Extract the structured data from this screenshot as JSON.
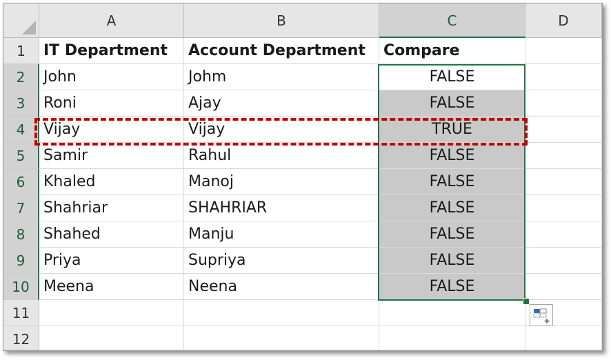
{
  "columns": [
    "A",
    "B",
    "C",
    "D"
  ],
  "rows": [
    "1",
    "2",
    "3",
    "4",
    "5",
    "6",
    "7",
    "8",
    "9",
    "10",
    "11",
    "12"
  ],
  "headers": {
    "a": "IT Department",
    "b": "Account Department",
    "c": "Compare"
  },
  "data": [
    {
      "it": "John",
      "account": "Johm",
      "compare": "FALSE"
    },
    {
      "it": "Roni",
      "account": "Ajay",
      "compare": "FALSE"
    },
    {
      "it": "Vijay",
      "account": "Vijay",
      "compare": "TRUE"
    },
    {
      "it": "Samir",
      "account": "Rahul",
      "compare": "FALSE"
    },
    {
      "it": "Khaled",
      "account": "Manoj",
      "compare": "FALSE"
    },
    {
      "it": "Shahriar",
      "account": "SHAHRIAR",
      "compare": "FALSE"
    },
    {
      "it": "Shahed",
      "account": "Manju",
      "compare": "FALSE"
    },
    {
      "it": "Priya",
      "account": "Supriya",
      "compare": "FALSE"
    },
    {
      "it": "Meena",
      "account": "Neena",
      "compare": "FALSE"
    }
  ],
  "colors": {
    "selection_accent": "#217346",
    "highlight_dashed": "#c00000",
    "selected_fill": "#c9c9c9"
  },
  "icons": {
    "quick_analysis": "quick-analysis-icon",
    "select_all": "select-all-triangle-icon"
  }
}
